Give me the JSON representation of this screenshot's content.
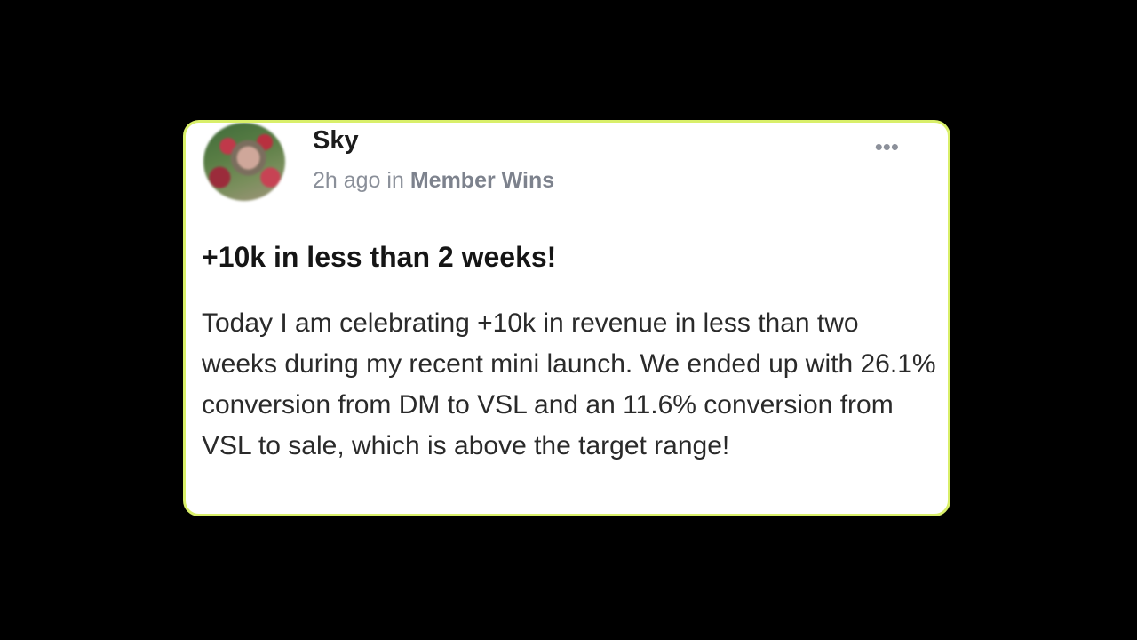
{
  "post": {
    "author": "Sky",
    "time": "2h ago",
    "in_word": "in",
    "space": "Member Wins",
    "more_icon": "more-horizontal-icon",
    "title": "+10k in less than 2 weeks!",
    "body": "Today I am celebrating +10k in revenue in less than two weeks during my recent mini launch. We ended up with 26.1% conversion from DM to VSL and an 11.6% conversion from VSL to sale, which is above the target range!"
  },
  "colors": {
    "card_border": "#d9ef6a",
    "background": "#000000",
    "meta_text": "#8a8f99"
  }
}
